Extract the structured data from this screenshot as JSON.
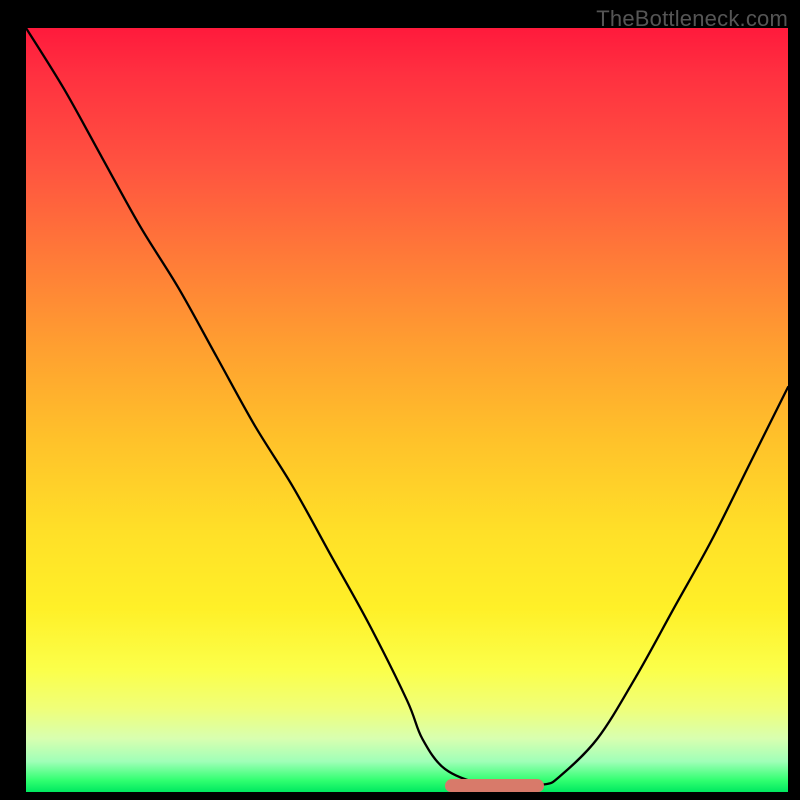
{
  "watermark": "TheBottleneck.com",
  "chart_data": {
    "type": "line",
    "title": "",
    "xlabel": "",
    "ylabel": "",
    "xlim": [
      0,
      100
    ],
    "ylim": [
      0,
      100
    ],
    "grid": false,
    "legend": false,
    "series": [
      {
        "name": "bottleneck-curve",
        "x": [
          0,
          5,
          10,
          15,
          20,
          25,
          30,
          35,
          40,
          45,
          50,
          52,
          55,
          60,
          64,
          68,
          70,
          75,
          80,
          85,
          90,
          95,
          100
        ],
        "values": [
          100,
          92,
          83,
          74,
          66,
          57,
          48,
          40,
          31,
          22,
          12,
          7,
          3,
          1,
          1,
          1,
          2,
          7,
          15,
          24,
          33,
          43,
          53
        ]
      }
    ],
    "annotations": [
      {
        "name": "optimal-range",
        "x_start": 55,
        "x_end": 68,
        "color": "#d87a6a"
      }
    ],
    "background_gradient": {
      "direction": "top-to-bottom",
      "stops": [
        {
          "pos": 0,
          "color": "#ff1a3c"
        },
        {
          "pos": 50,
          "color": "#ffc22a"
        },
        {
          "pos": 85,
          "color": "#fbff4a"
        },
        {
          "pos": 100,
          "color": "#00e860"
        }
      ]
    }
  }
}
